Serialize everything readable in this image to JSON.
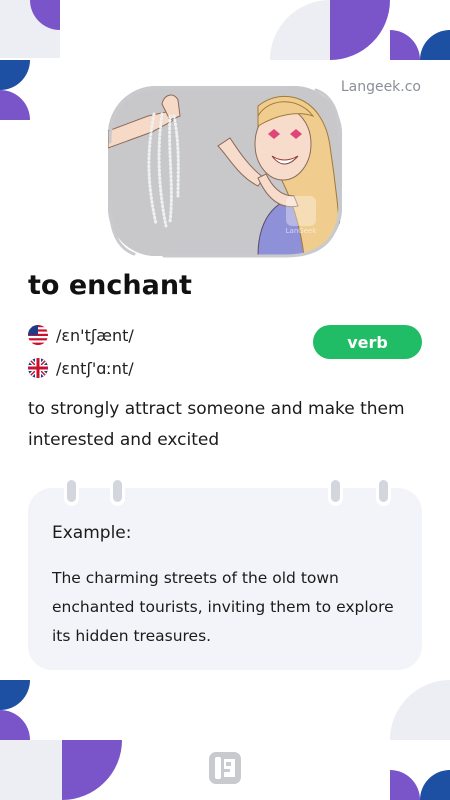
{
  "brand": {
    "site": "Langeek.co",
    "logo_icon": "langeek-logo-icon"
  },
  "illustration": {
    "description_icon": "woman-enchanted-by-pearl-necklace-illustration",
    "watermark_icon": "langeek-watermark-icon"
  },
  "entry": {
    "word": "to enchant",
    "part_of_speech": "verb",
    "pronunciations": [
      {
        "accent_icon": "us-flag-icon",
        "ipa": "/ɛn'tʃænt/"
      },
      {
        "accent_icon": "uk-flag-icon",
        "ipa": "/ɛntʃ'ɑːnt/"
      }
    ],
    "definition": "to strongly attract someone and make them interested and excited"
  },
  "example": {
    "label": "Example:",
    "text": "The charming streets of the old town enchanted tourists, inviting them to explore its hidden treasures."
  },
  "colors": {
    "accent_purple": "#7a55c9",
    "accent_blue": "#1d4fa3",
    "light_gray": "#e9eaf0",
    "badge_green": "#21bd66",
    "card_bg": "#f3f4f9"
  }
}
